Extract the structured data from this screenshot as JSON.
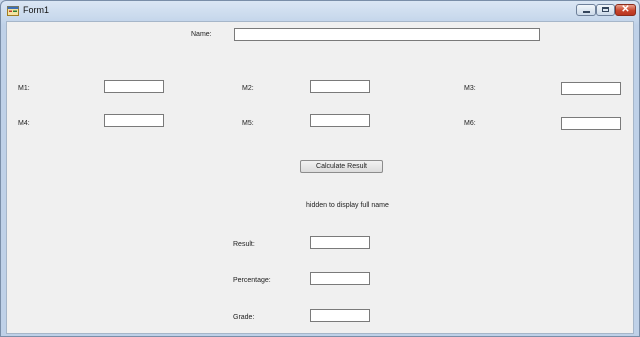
{
  "window": {
    "title": "Form1",
    "icons": {
      "app": "form-app-icon",
      "minimize": "minimize-icon",
      "maximize": "maximize-icon",
      "close": "close-icon"
    },
    "close_glyph": "✕"
  },
  "form": {
    "name_label": "Name:",
    "name_value": "",
    "marks": [
      {
        "label": "M1:",
        "value": ""
      },
      {
        "label": "M2:",
        "value": ""
      },
      {
        "label": "M3:",
        "value": ""
      },
      {
        "label": "M4:",
        "value": ""
      },
      {
        "label": "M5:",
        "value": ""
      },
      {
        "label": "M6:",
        "value": ""
      }
    ],
    "calculate_button": "Calculate Result",
    "fullname_label": "hidden to display full name",
    "result_label": "Result:",
    "result_value": "",
    "percentage_label": "Percentage:",
    "percentage_value": "",
    "grade_label": "Grade:",
    "grade_value": ""
  },
  "colors": {
    "titlebar": "#c7d8ec",
    "client": "#f0f0f0",
    "close_button": "#c8452c"
  }
}
